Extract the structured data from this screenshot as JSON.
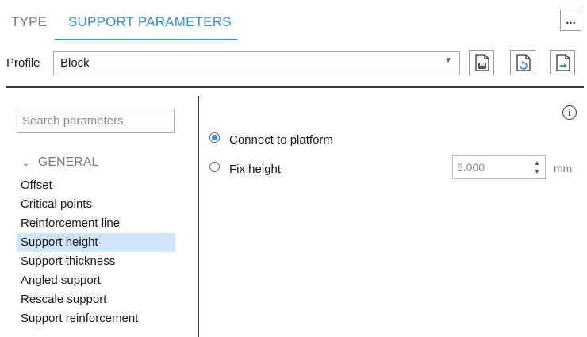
{
  "tabs": [
    {
      "label": "TYPE",
      "active": false
    },
    {
      "label": "SUPPORT PARAMETERS",
      "active": true
    }
  ],
  "more_button": {
    "label": "..."
  },
  "profile": {
    "label": "Profile",
    "value": "Block",
    "buttons": [
      "profile-save-icon",
      "profile-reload-icon",
      "profile-export-icon"
    ]
  },
  "search": {
    "placeholder": "Search parameters"
  },
  "general": {
    "label": "GENERAL",
    "expanded": true,
    "items": [
      {
        "label": "Offset",
        "selected": false
      },
      {
        "label": "Critical points",
        "selected": false
      },
      {
        "label": "Reinforcement line",
        "selected": false
      },
      {
        "label": "Support height",
        "selected": true
      },
      {
        "label": "Support thickness",
        "selected": false
      },
      {
        "label": "Angled support",
        "selected": false
      },
      {
        "label": "Rescale support",
        "selected": false
      },
      {
        "label": "Support reinforcement",
        "selected": false
      }
    ]
  },
  "height_options": {
    "connect_to_platform": {
      "label": "Connect to platform",
      "checked": true
    },
    "fix_height": {
      "label": "Fix height",
      "checked": false,
      "value": "5.000",
      "unit": "mm"
    }
  },
  "colors": {
    "accent": "#2e8fd6",
    "selection": "#cfe6fa"
  }
}
